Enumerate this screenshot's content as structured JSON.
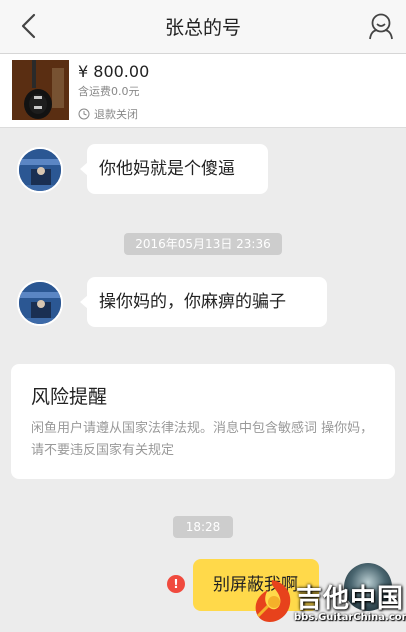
{
  "header": {
    "title": "张总的号",
    "back_icon": "back-chevron-icon",
    "profile_icon": "user-face-icon"
  },
  "product": {
    "price": "¥ 800.00",
    "shipping": "含运费0.0元",
    "refund_status": "退款关闭",
    "status_icon": "clock-icon"
  },
  "messages": [
    {
      "sender": "other",
      "text": "你他妈就是个傻逼"
    },
    {
      "sender": "other",
      "text": "操你妈的，你麻痹的骗子"
    }
  ],
  "timestamps": [
    "2016年05月13日 23:36",
    "18:28"
  ],
  "risk_notice": {
    "title": "风险提醒",
    "body": "闲鱼用户请遵从国家法律法规。消息中包含敏感词 操你妈，请不要违反国家有关规定"
  },
  "my_message": {
    "text": "别屏蔽我啊",
    "status_icon": "send-failed-icon",
    "status_symbol": "!"
  },
  "watermark": {
    "text": "吉他中国",
    "url": "bbs.GuitarChina.com"
  },
  "colors": {
    "background": "#ececec",
    "my_bubble": "#ffd94a",
    "error": "#f04a3e"
  }
}
